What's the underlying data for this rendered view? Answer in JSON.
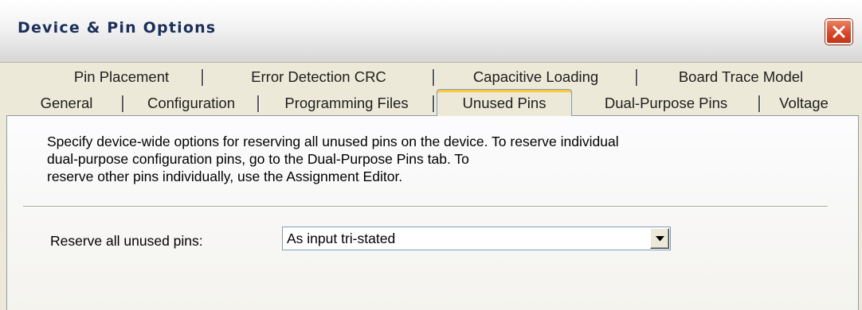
{
  "window": {
    "title": "Device & Pin Options"
  },
  "tabs": {
    "row1": [
      "Pin Placement",
      "Error Detection CRC",
      "Capacitive Loading",
      "Board Trace Model"
    ],
    "row2": [
      "General",
      "Configuration",
      "Programming Files",
      "Unused Pins",
      "Dual-Purpose Pins",
      "Voltage"
    ],
    "active": "Unused Pins"
  },
  "panel": {
    "description_lines": [
      "Specify device-wide options for reserving all unused pins on the device. To reserve individual",
      "dual-purpose configuration pins, go to the Dual-Purpose Pins tab. To",
      "reserve other pins individually, use the Assignment Editor."
    ],
    "reserve_label": "Reserve all unused pins:",
    "reserve_value": "As input tri-stated"
  },
  "icons": {
    "close": "close-icon",
    "dropdown": "chevron-down-icon"
  },
  "colors": {
    "title_text": "#1b2f5a",
    "close_button": "#d7482a",
    "active_tab_accent": "#ffc73c",
    "dialog_background": "#ece9d8"
  }
}
